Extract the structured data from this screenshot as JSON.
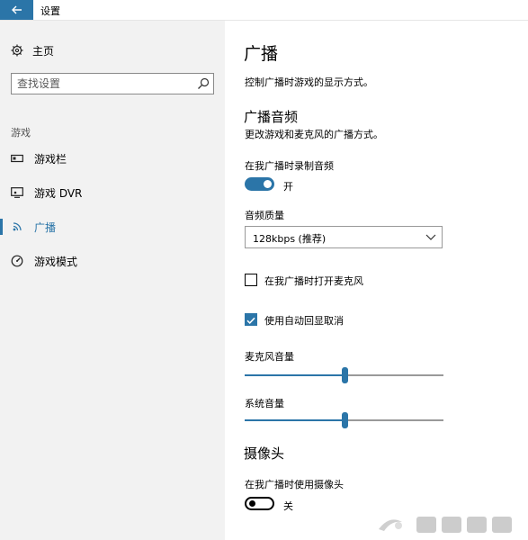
{
  "window": {
    "title": "设置"
  },
  "sidebar": {
    "home_label": "主页",
    "search_placeholder": "查找设置",
    "section_label": "游戏",
    "items": [
      {
        "label": "游戏栏",
        "icon": "game-bar-icon",
        "active": false
      },
      {
        "label": "游戏 DVR",
        "icon": "game-dvr-icon",
        "active": false
      },
      {
        "label": "广播",
        "icon": "broadcast-icon",
        "active": true
      },
      {
        "label": "游戏模式",
        "icon": "game-mode-icon",
        "active": false
      }
    ]
  },
  "content": {
    "title": "广播",
    "description": "控制广播时游戏的显示方式。",
    "audio_section": {
      "heading": "广播音频",
      "subtitle": "更改游戏和麦克风的广播方式。",
      "record_audio_label": "在我广播时录制音频",
      "record_audio_on": true,
      "record_audio_state": "开",
      "quality_label": "音频质量",
      "quality_value": "128kbps (推荐)",
      "mic_checkbox_label": "在我广播时打开麦克风",
      "mic_checkbox_checked": false,
      "echo_checkbox_label": "使用自动回显取消",
      "echo_checkbox_checked": true,
      "mic_volume_label": "麦克风音量",
      "mic_volume_fraction": 0.5,
      "system_volume_label": "系统音量",
      "system_volume_fraction": 0.5
    },
    "camera_section": {
      "heading": "摄像头",
      "camera_label": "在我广播时使用摄像头",
      "camera_on": false,
      "camera_state": "关"
    }
  },
  "watermark": {
    "text": "系统之家"
  },
  "colors": {
    "accent": "#2b75a8",
    "sidebar_bg": "#f2f2f2"
  }
}
